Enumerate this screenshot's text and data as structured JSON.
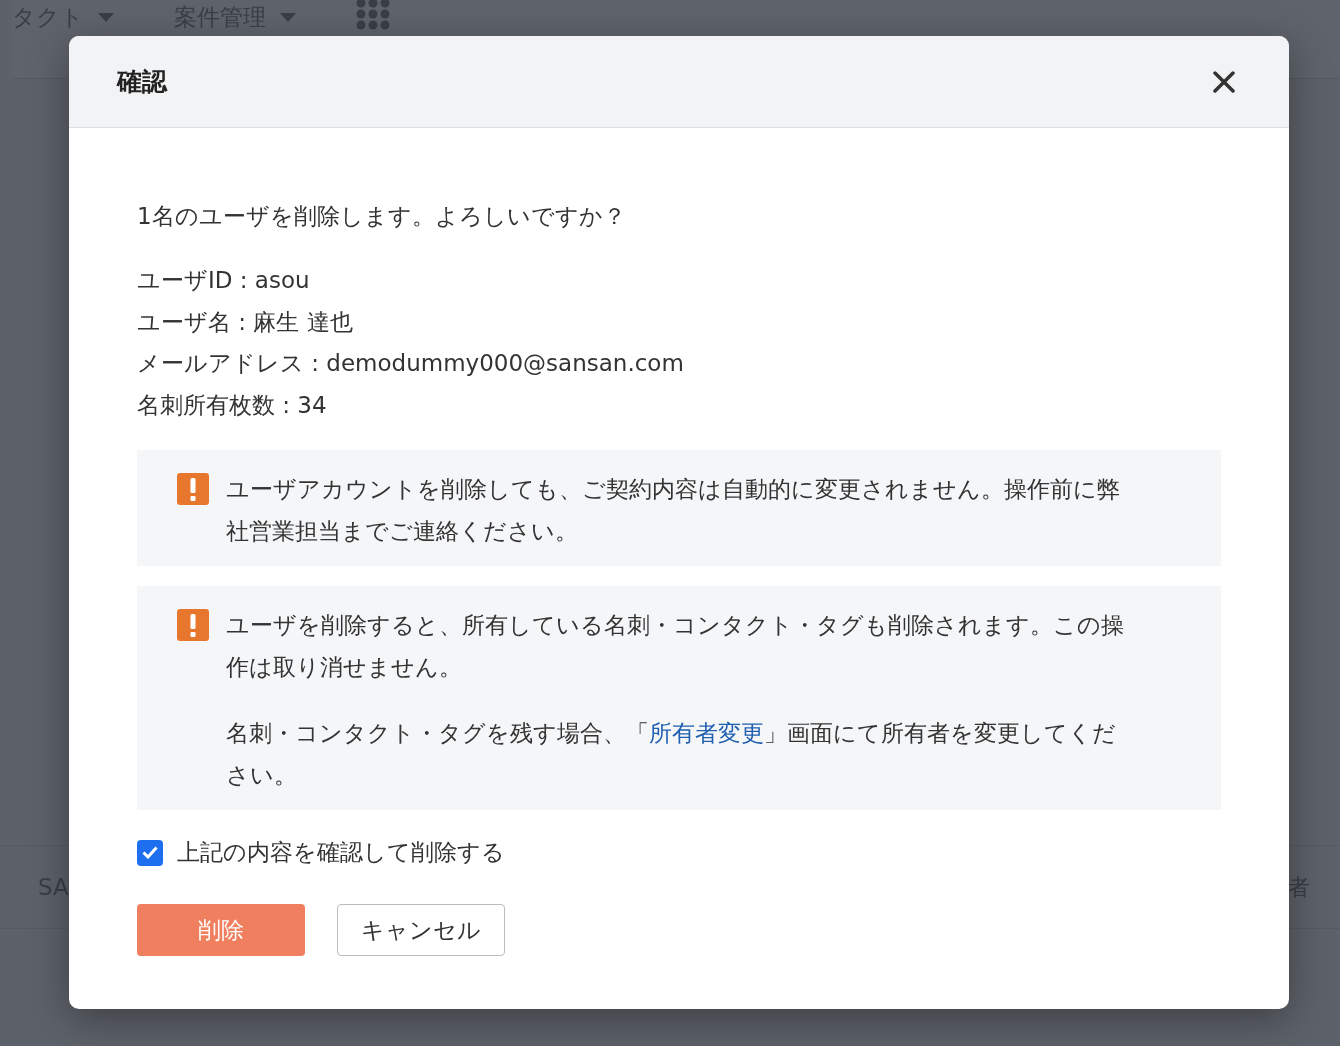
{
  "background": {
    "nav_items": [
      {
        "label": "タクト"
      },
      {
        "label": "案件管理"
      }
    ],
    "table_headers": [
      "SA",
      "者"
    ]
  },
  "dialog": {
    "title": "確認",
    "message": "1名のユーザを削除します。よろしいですか？",
    "details": [
      "ユーザID : asou",
      "ユーザ名 : 麻生 達也",
      "メールアドレス : demodummy000@sansan.com",
      "名刺所有枚数 : 34"
    ],
    "notices": [
      {
        "kind": "warning",
        "paragraphs": [
          {
            "kind": "text",
            "text": "ユーザアカウントを削除しても、ご契約内容は自動的に変更されません。操作前に弊社営業担当までご連絡ください。"
          }
        ]
      },
      {
        "kind": "warning",
        "paragraphs": [
          {
            "kind": "text",
            "text": "ユーザを削除すると、所有している名刺・コンタクト・タグも削除されます。この操作は取り消せません。"
          },
          {
            "kind": "link",
            "before": "名刺・コンタクト・タグを残す場合、「",
            "link": "所有者変更",
            "after": "」画面にて所有者を変更してください。"
          }
        ]
      }
    ],
    "confirm": {
      "label": "上記の内容を確認して削除する",
      "checked": true
    },
    "buttons": [
      {
        "label": "削除",
        "kind": "danger"
      },
      {
        "label": "キャンセル",
        "kind": "secondary"
      }
    ]
  }
}
